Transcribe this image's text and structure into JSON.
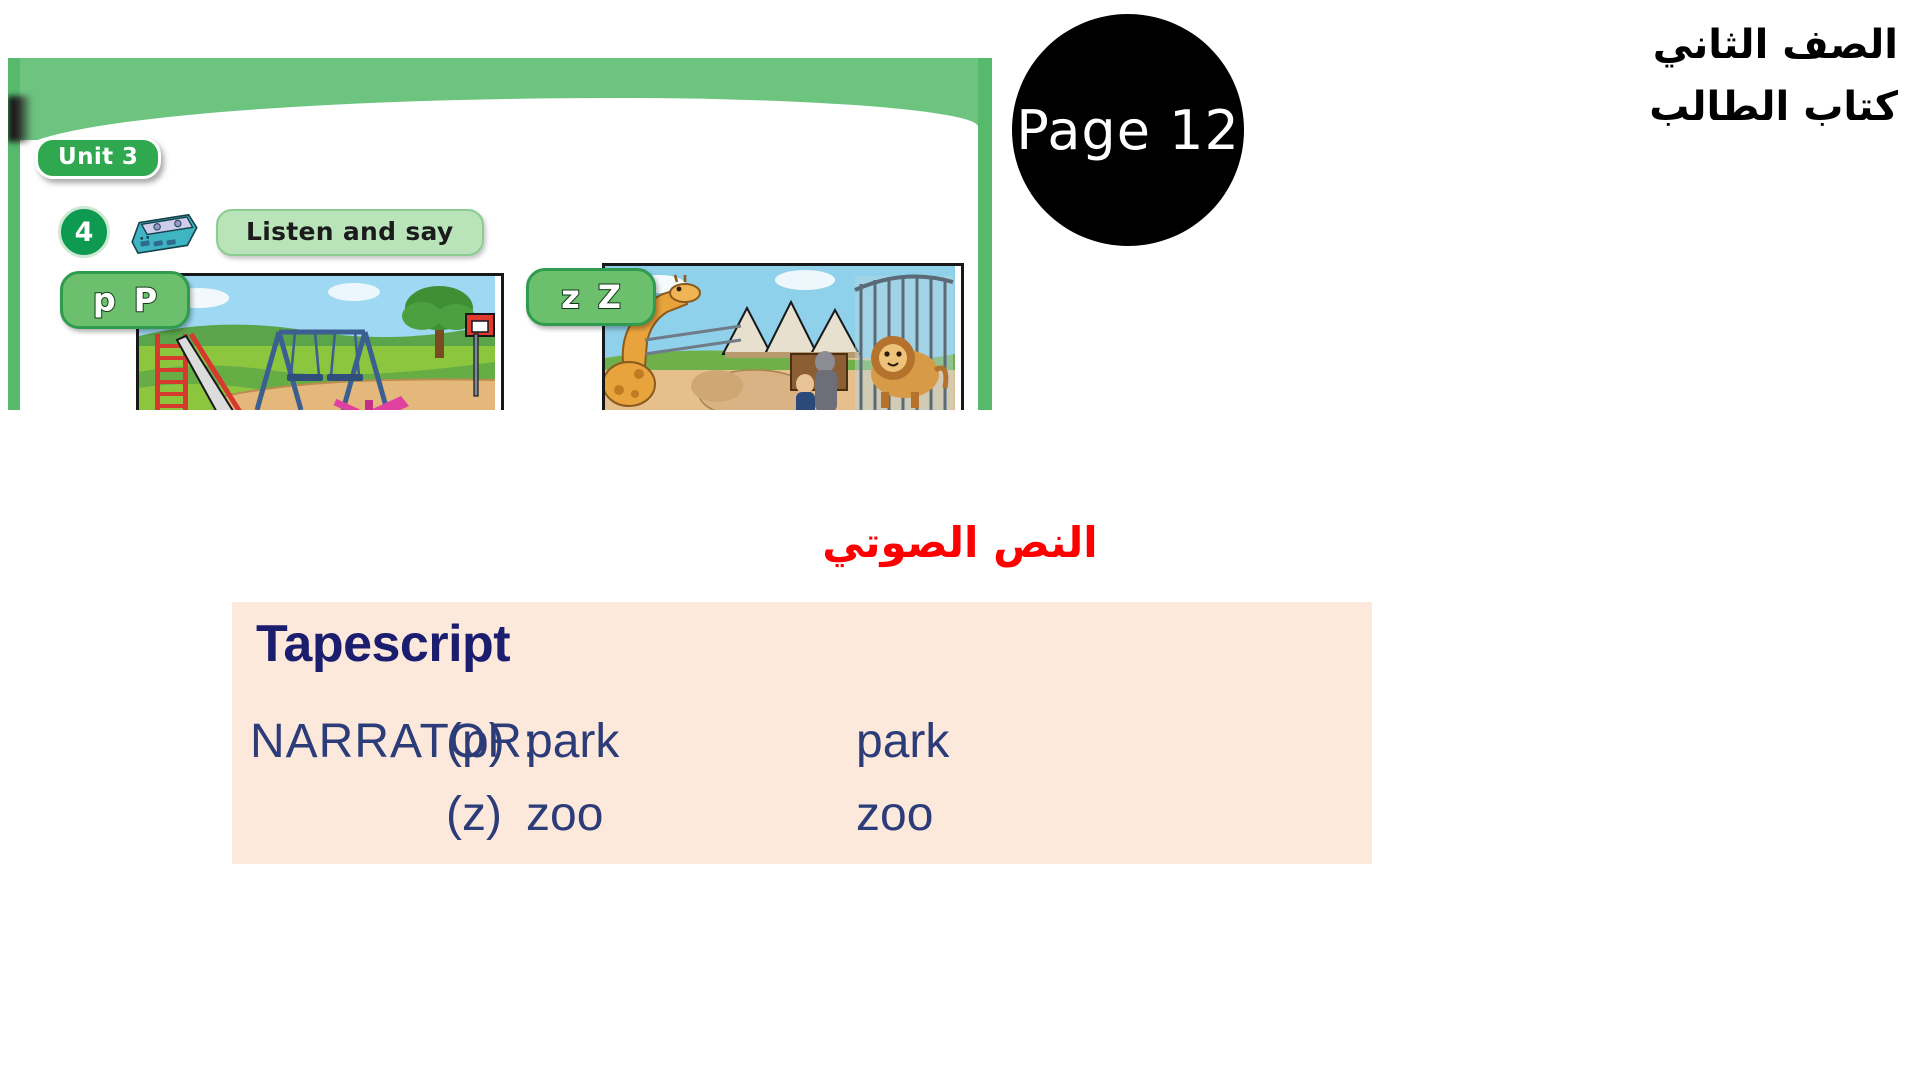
{
  "header": {
    "page_badge": "Page 12",
    "arabic_lines": [
      "الصف الثاني",
      "كتاب الطالب"
    ]
  },
  "book_scan": {
    "unit_badge": "Unit 3",
    "exercise_number": "4",
    "cassette_icon": "cassette-tape-icon",
    "instruction": "Listen and say",
    "letter_badges": [
      {
        "lower": "p",
        "upper": "P"
      },
      {
        "lower": "z",
        "upper": "Z"
      }
    ],
    "illustrations": [
      {
        "name": "park-playground-illustration",
        "alt": "park playground with slide, swings, seesaw and basketball hoop"
      },
      {
        "name": "zoo-illustration",
        "alt": "zoo with giraffe, lion in cage and visitors"
      }
    ]
  },
  "red_heading": "النص الصوتي",
  "tapescript": {
    "title": "Tapescript",
    "rows": [
      {
        "speaker": "NARRATOR:",
        "phoneme": "(p)",
        "word": "park",
        "word2": "park"
      },
      {
        "speaker": "",
        "phoneme": "(z)",
        "word": "zoo",
        "word2": "zoo"
      }
    ]
  },
  "colors": {
    "green_band": "#6cc47f",
    "badge_green": "#2fa84f",
    "pill_green": "#b9e3b9",
    "tapescript_bg": "#fde8dc",
    "tapescript_ink": "#1b1d6e",
    "red": "#ff0000",
    "black": "#000000"
  }
}
